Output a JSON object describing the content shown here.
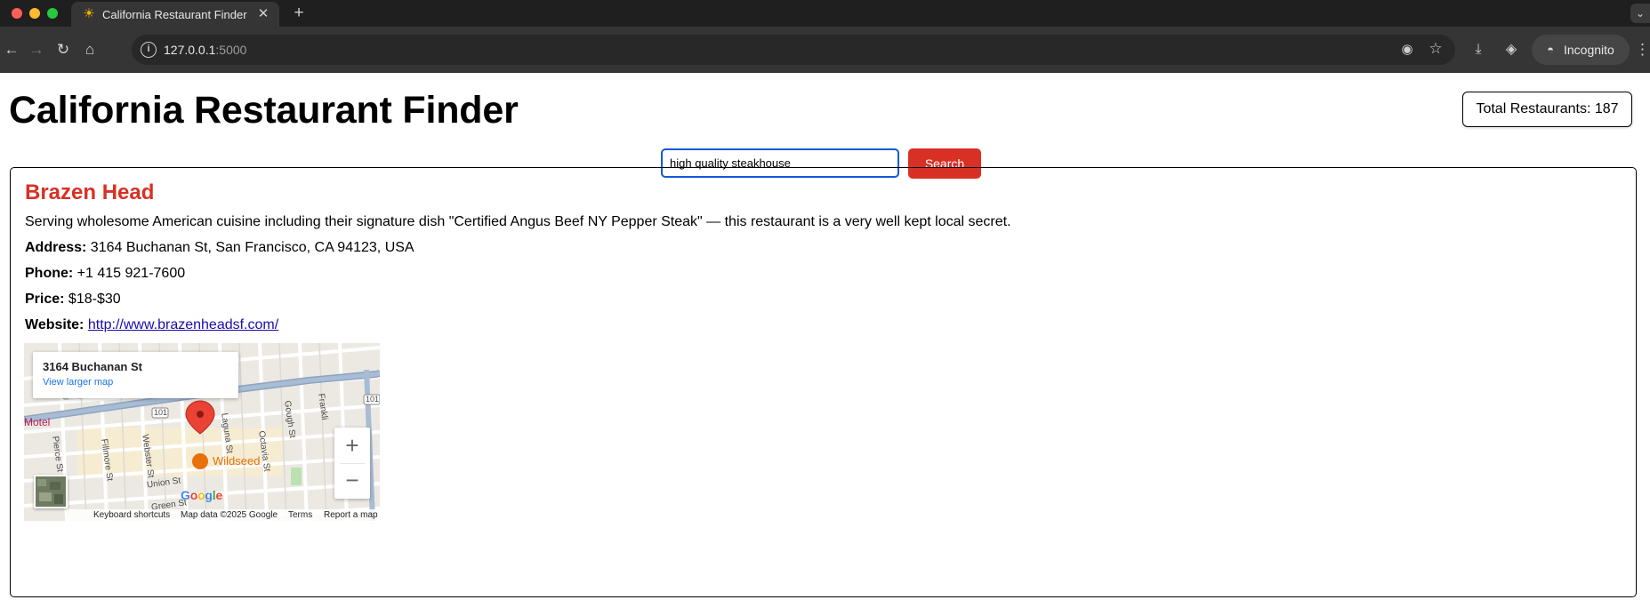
{
  "browser": {
    "tab_title": "California Restaurant Finder",
    "url_host": "127.0.0.1",
    "url_port": ":5000",
    "incognito_label": "Incognito"
  },
  "page": {
    "title": "California Restaurant Finder",
    "total_restaurants": "Total Restaurants: 187"
  },
  "search": {
    "value": "high quality steakhouse",
    "button_label": "Search"
  },
  "restaurant": {
    "name": "Brazen Head",
    "description": "Serving wholesome American cuisine including their signature dish \"Certified Angus Beef NY Pepper Steak\" — this restaurant is a very well kept local secret.",
    "address_label": "Address:",
    "address": " 3164 Buchanan St, San Francisco, CA 94123, USA",
    "phone_label": "Phone:",
    "phone": " +1 415 921-7600",
    "price_label": "Price:",
    "price": " $18-$30",
    "website_label": "Website:",
    "website": "http://www.brazenheadsf.com/"
  },
  "map": {
    "popup_title": "3164 Buchanan St",
    "popup_link": "View larger map",
    "labels": {
      "motel": "Motel",
      "wildseed": "Wildseed",
      "fillmore": "Fillmore St",
      "webster": "Webster St",
      "laguna": "Laguna St",
      "octavia": "Octavia St",
      "gough": "Gough St",
      "franklin": "Frankli",
      "pierce": "Pierce St",
      "union": "Union St",
      "green": "Green St",
      "hwy": "101",
      "hwy2": "101"
    },
    "footer": {
      "shortcuts": "Keyboard shortcuts",
      "map_data": "Map data ©2025 Google",
      "terms": "Terms",
      "report": "Report a map error"
    },
    "logo": [
      "G",
      "o",
      "o",
      "g",
      "l",
      "e"
    ]
  },
  "colors": {
    "accent_red": "#d93025",
    "link_blue": "#1a0dab",
    "input_border": "#1558d6"
  }
}
